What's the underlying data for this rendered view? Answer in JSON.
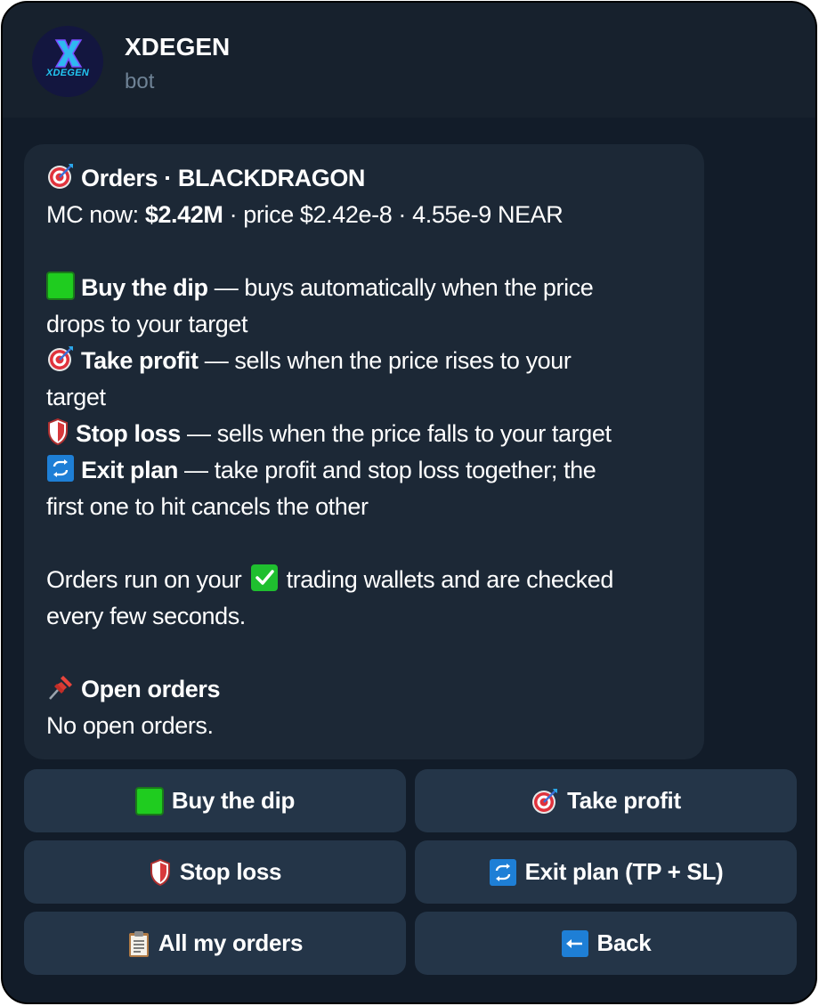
{
  "header": {
    "title": "XDEGEN",
    "subtitle": "bot",
    "avatar_text": "XDEGEN"
  },
  "message": {
    "title": "Orders · BLACKDRAGON",
    "mc_prefix": "MC now: ",
    "mc_value": "$2.42M",
    "mc_rest": " · price $2.42e-8 · 4.55e-9 NEAR",
    "buy_dip_label": "Buy the dip",
    "buy_dip_desc": " — buys automatically when the price",
    "buy_dip_desc2": "drops to your target",
    "take_profit_label": "Take profit",
    "take_profit_desc": " — sells when the price rises to your",
    "take_profit_desc2": "target",
    "stop_loss_label": "Stop loss",
    "stop_loss_desc": " — sells when the price falls to your target",
    "exit_plan_label": "Exit plan",
    "exit_plan_desc": " — take profit and stop loss together; the",
    "exit_plan_desc2": "first one to hit cancels the other",
    "wallets_prefix": "Orders run on your ",
    "wallets_suffix": " trading wallets and are checked",
    "wallets_line2": "every few seconds.",
    "open_orders_heading": "Open orders",
    "open_orders_status": "No open orders."
  },
  "buttons": {
    "buy_dip": "Buy the dip",
    "take_profit": "Take profit",
    "stop_loss": "Stop loss",
    "exit_plan": "Exit plan (TP + SL)",
    "all_orders": "All my orders",
    "back": "Back"
  },
  "icons": {
    "target": "direct-hit-icon",
    "green_square": "green-square-icon",
    "shield": "shield-icon",
    "repeat": "repeat-icon",
    "check": "check-mark-icon",
    "pin": "pushpin-icon",
    "clipboard": "clipboard-icon",
    "back_arrow": "left-arrow-icon"
  },
  "colors": {
    "background": "#121c29",
    "header": "#17212d",
    "bubble": "#1c2836",
    "button": "#243548",
    "subtitle": "#6f8396",
    "accent_blue": "#1e7fd6",
    "accent_green": "#1fcc1f"
  }
}
